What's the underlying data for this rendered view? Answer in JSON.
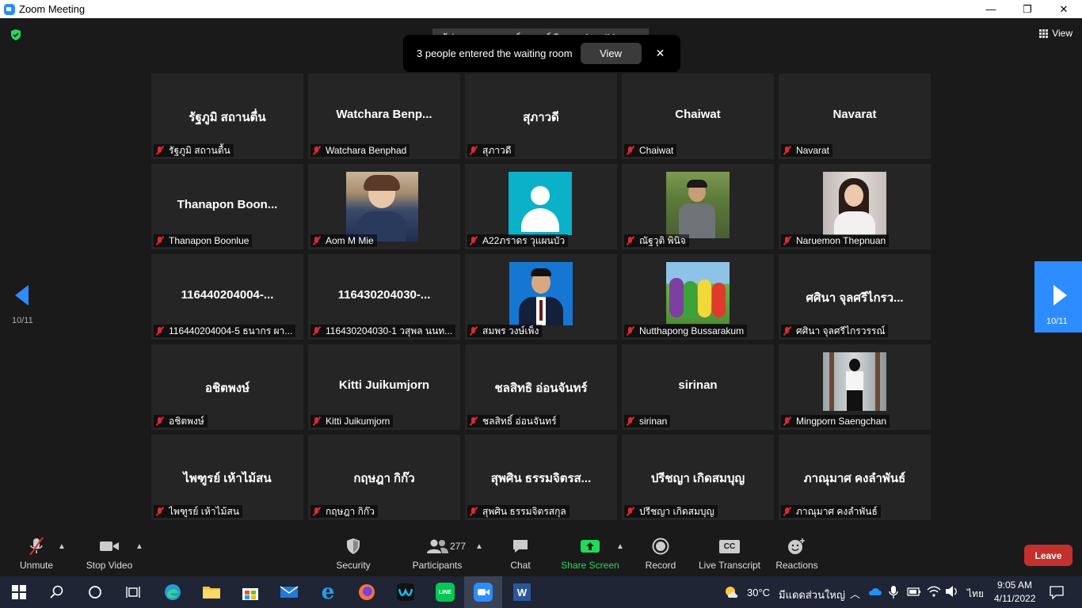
{
  "window": {
    "title": "Zoom Meeting",
    "minimize": "—",
    "restore": "❐",
    "close": "✕"
  },
  "header": {
    "talking_text": "ผู้ช่วยศาสตราจารย์อานนท์ นิยมผล is talking...",
    "view_label": "View"
  },
  "waiting_room": {
    "message": "3 people entered the waiting room",
    "view_button": "View",
    "close": "✕"
  },
  "pagination": {
    "left": "10/11",
    "right": "10/11"
  },
  "participants": [
    {
      "display": "รัฐภูมิ สถานตื่น",
      "label": "รัฐภูมิ สถานตื้น",
      "video": false
    },
    {
      "display": "Watchara  Benp...",
      "label": "Watchara Benphad",
      "video": false
    },
    {
      "display": "สุภาวดี",
      "label": "สุภาวดี",
      "video": false
    },
    {
      "display": "Chaiwat",
      "label": "Chaiwat",
      "video": false
    },
    {
      "display": "Navarat",
      "label": "Navarat",
      "video": false
    },
    {
      "display": "Thanapon  Boon...",
      "label": "Thanapon Boonlue",
      "video": false
    },
    {
      "display": "",
      "label": "Aom M Mie",
      "video": true
    },
    {
      "display": "",
      "label": "A22ภราดร วุแผนบัว",
      "video": true
    },
    {
      "display": "",
      "label": "ณัฐวุติ พินิจ",
      "video": true
    },
    {
      "display": "",
      "label": "Naruemon Thepnuan",
      "video": true
    },
    {
      "display": "116440204004-...",
      "label": "116440204004-5 ธนากร ผา...",
      "video": false
    },
    {
      "display": "116430204030-...",
      "label": "116430204030-1 วสุพล นนท...",
      "video": false
    },
    {
      "display": "",
      "label": "สมพร วงษ์เพ็ง",
      "video": true
    },
    {
      "display": "",
      "label": "Nutthapong Bussarakum",
      "video": true
    },
    {
      "display": "ศศินา จุลศรีไกรว...",
      "label": "ศศินา จุลศรีไกรวรรณ์",
      "video": false
    },
    {
      "display": "อชิตพงษ์",
      "label": "อชิตพงษ์",
      "video": false
    },
    {
      "display": "Kitti Juikumjorn",
      "label": "Kitti Juikumjorn",
      "video": false
    },
    {
      "display": "ชลสิทธิ อ่อนจันทร์",
      "label": "ชลสิทธิ์ อ่อนจันทร์",
      "video": false
    },
    {
      "display": "sirinan",
      "label": "sirinan",
      "video": false
    },
    {
      "display": "",
      "label": "Mingporn Saengchan",
      "video": true
    },
    {
      "display": "ไพฑูรย์ เห้าไม้สน",
      "label": "ไพฑูรย์ เห้าไม้สน",
      "video": false
    },
    {
      "display": "กฤษฎา กิก๊ว",
      "label": "กฤษฎา กิก๊ว",
      "video": false
    },
    {
      "display": "สุพศิน ธรรมจิตรส...",
      "label": "สุพศิน ธรรมจิตรสกุล",
      "video": false
    },
    {
      "display": "ปรีชญา เกิดสมบุญ",
      "label": "ปรีชญา เกิดสมบุญ",
      "video": false
    },
    {
      "display": "ภาณุมาศ คงลำพันธ์",
      "label": "ภาณุมาศ คงลำพันธ์",
      "video": false
    }
  ],
  "toolbar": {
    "unmute": "Unmute",
    "stop_video": "Stop Video",
    "security": "Security",
    "participants": "Participants",
    "participants_count": "277",
    "chat": "Chat",
    "share_screen": "Share Screen",
    "record": "Record",
    "live_transcript": "Live Transcript",
    "cc": "CC",
    "reactions": "Reactions",
    "leave": "Leave"
  },
  "taskbar": {
    "weather_temp": "30°C",
    "weather_text": "มีแดดส่วนใหญ่",
    "language": "ไทย",
    "time": "9:05 AM",
    "date": "4/11/2022"
  },
  "colors": {
    "accent": "#2d8cff",
    "share_green": "#23d959",
    "leave_red": "#c4302b",
    "mute_red": "#e02828"
  }
}
